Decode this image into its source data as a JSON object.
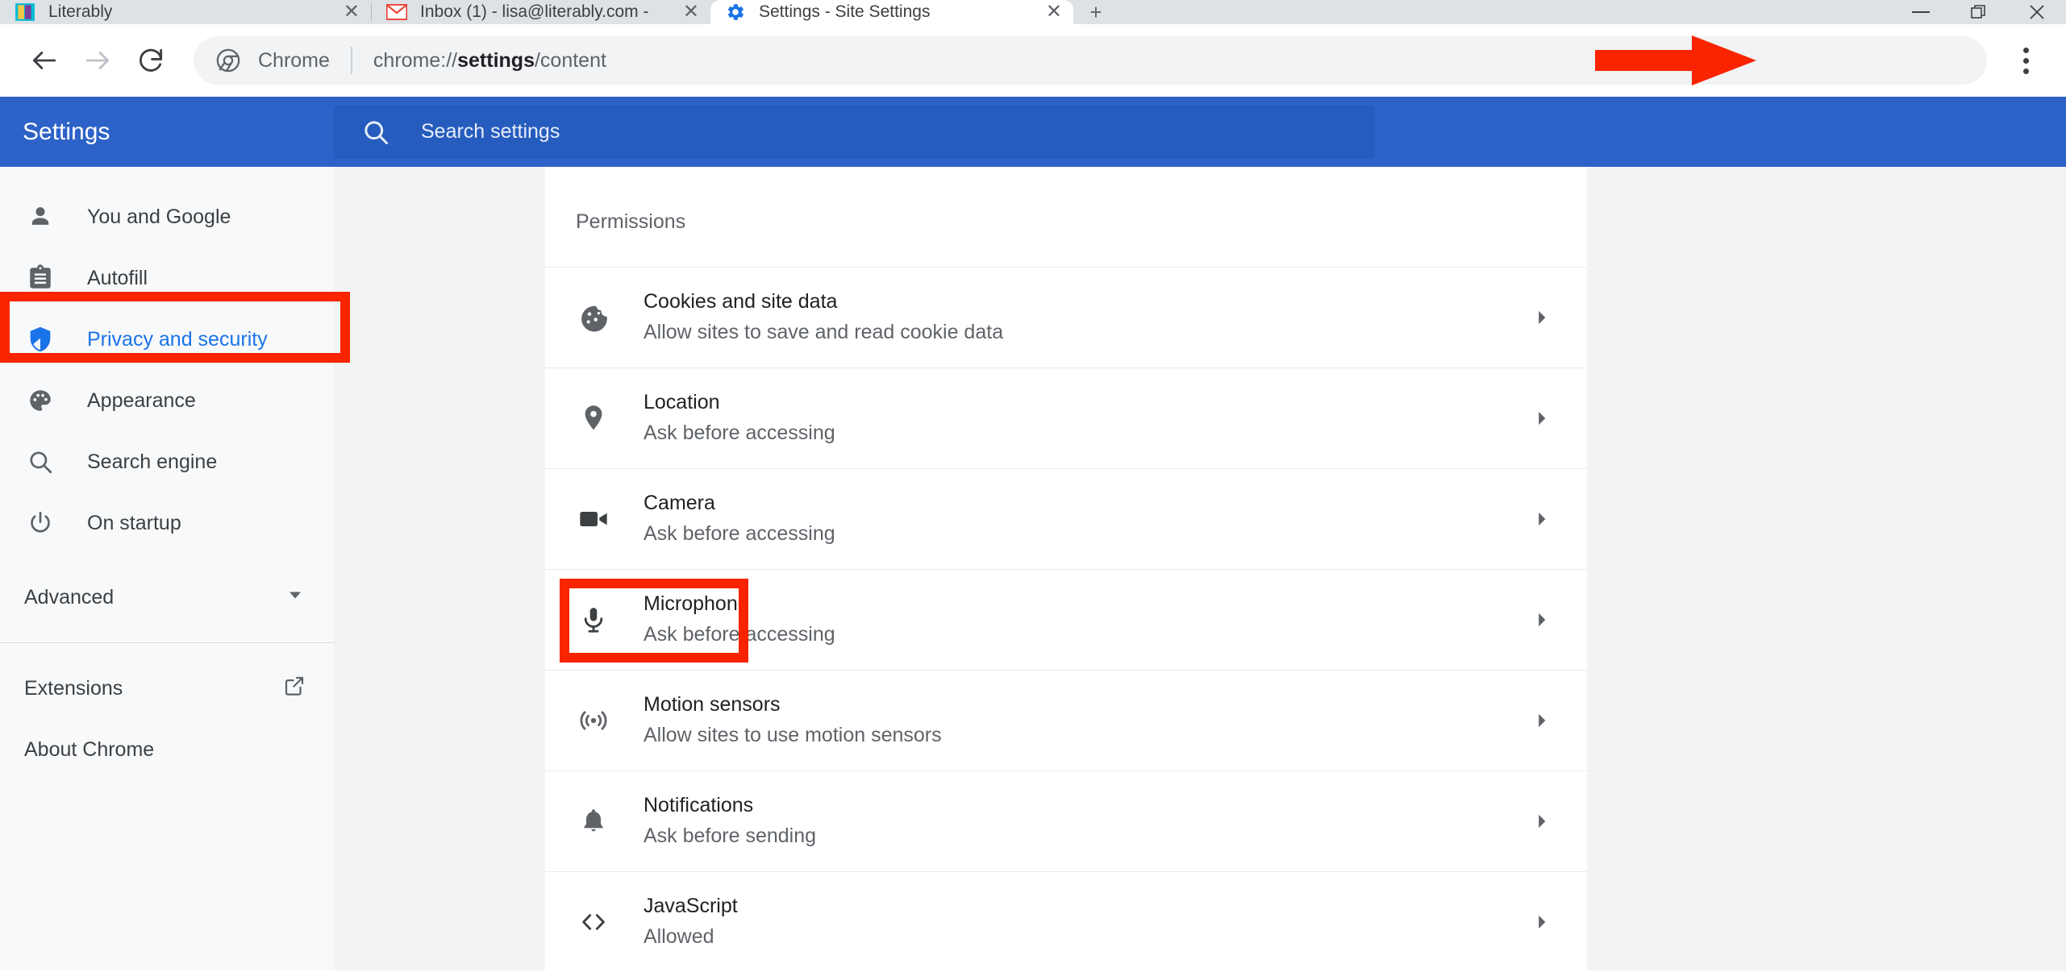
{
  "window": {
    "controls": {
      "minimize": "–",
      "maximize": "❐",
      "close": "✕"
    }
  },
  "tabs": [
    {
      "title": "Literably",
      "favicon": "book-icon",
      "close": "✕",
      "active": false
    },
    {
      "title": "Inbox (1) - lisa@literably.com -",
      "favicon": "gmail-icon",
      "close": "✕",
      "active": false
    },
    {
      "title": "Settings - Site Settings",
      "favicon": "chrome-settings-icon",
      "close": "✕",
      "active": true
    }
  ],
  "new_tab_label": "+",
  "toolbar": {
    "back_icon": "back-arrow-icon",
    "forward_icon": "forward-arrow-icon",
    "reload_icon": "reload-icon",
    "chrome_icon": "chrome-logo-icon",
    "chrome_label": "Chrome",
    "url_prefix": "chrome://",
    "url_bold": "settings",
    "url_suffix": "/content",
    "menu_icon": "three-dot-menu-icon"
  },
  "settings_header": {
    "title": "Settings",
    "search_icon": "search-icon",
    "search_placeholder": "Search settings",
    "search_value": ""
  },
  "sidebar": {
    "items": [
      {
        "label": "You and Google",
        "icon": "person-icon",
        "selected": false
      },
      {
        "label": "Autofill",
        "icon": "clipboard-icon",
        "selected": false
      },
      {
        "label": "Privacy and security",
        "icon": "shield-icon",
        "selected": true
      },
      {
        "label": "Appearance",
        "icon": "palette-icon",
        "selected": false
      },
      {
        "label": "Search engine",
        "icon": "magnifier-icon",
        "selected": false
      },
      {
        "label": "On startup",
        "icon": "power-icon",
        "selected": false
      }
    ],
    "advanced": {
      "label": "Advanced",
      "icon": "chevron-down-icon"
    },
    "links": [
      {
        "label": "Extensions",
        "icon": "external-link-icon"
      },
      {
        "label": "About Chrome",
        "icon": ""
      }
    ]
  },
  "main": {
    "section_title": "Permissions",
    "permissions": [
      {
        "title": "Cookies and site data",
        "subtitle": "Allow sites to save and read cookie data",
        "icon": "cookie-icon",
        "arrow": "chevron-right-icon"
      },
      {
        "title": "Location",
        "subtitle": "Ask before accessing",
        "icon": "location-pin-icon",
        "arrow": "chevron-right-icon"
      },
      {
        "title": "Camera",
        "subtitle": "Ask before accessing",
        "icon": "camera-icon",
        "arrow": "chevron-right-icon"
      },
      {
        "title": "Microphone",
        "subtitle": "Ask before accessing",
        "icon": "microphone-icon",
        "arrow": "chevron-right-icon"
      },
      {
        "title": "Motion sensors",
        "subtitle": "Allow sites to use motion sensors",
        "icon": "motion-sensor-icon",
        "arrow": "chevron-right-icon"
      },
      {
        "title": "Notifications",
        "subtitle": "Ask before sending",
        "icon": "bell-icon",
        "arrow": "chevron-right-icon"
      },
      {
        "title": "JavaScript",
        "subtitle": "Allowed",
        "icon": "code-brackets-icon",
        "arrow": "chevron-right-icon"
      }
    ]
  },
  "annotations": {
    "highlight_color": "#fa2400",
    "boxes": [
      {
        "target": "sidebar-item-privacy-and-security"
      },
      {
        "target": "permission-row-microphone"
      }
    ],
    "arrow": {
      "target": "three-dot-menu-icon",
      "direction": "right"
    }
  },
  "colors": {
    "header_blue": "#2d63c8",
    "accent_blue": "#1a73e8",
    "annotation_red": "#fa2400",
    "tabstrip": "#dee1e6",
    "sidebar_bg": "#f8f9fa",
    "page_bg": "#f1f3f4"
  }
}
